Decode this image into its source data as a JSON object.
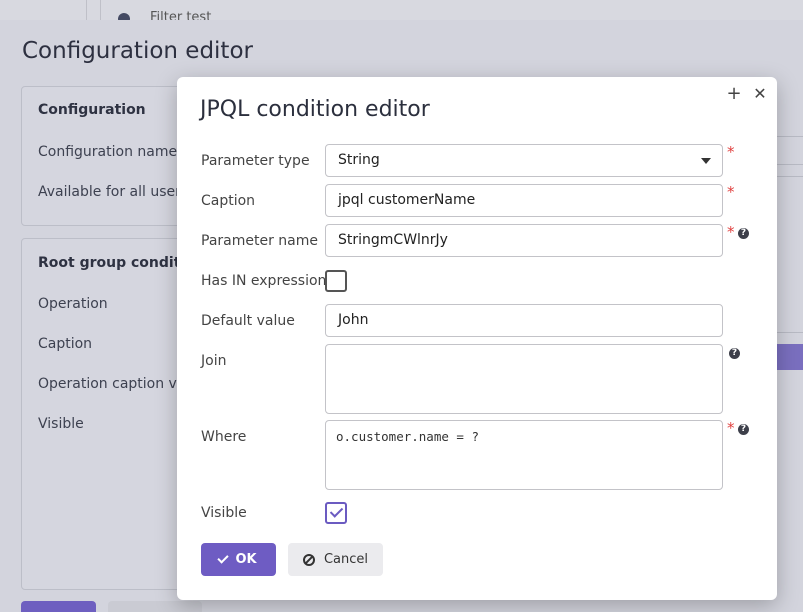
{
  "background": {
    "top_item_label": "Filter test",
    "page_title": "Configuration editor",
    "configuration_panel": {
      "header": "Configuration",
      "fields": [
        "Configuration name",
        "Available for all users"
      ]
    },
    "root_group_panel": {
      "header": "Root group condition",
      "fields": [
        "Operation",
        "Caption",
        "Operation caption vis",
        "Visible"
      ]
    }
  },
  "dialog": {
    "title": "JPQL condition editor",
    "maximize_glyph": "+",
    "close_glyph": "✕",
    "parameter_type": {
      "label": "Parameter type",
      "value": "String"
    },
    "caption": {
      "label": "Caption",
      "value": "jpql customerName"
    },
    "parameter_name": {
      "label": "Parameter name",
      "value": "StringmCWlnrJy"
    },
    "has_in_expression": {
      "label": "Has IN expression",
      "checked": false
    },
    "default_value": {
      "label": "Default value",
      "value": "John"
    },
    "join": {
      "label": "Join",
      "value": ""
    },
    "where": {
      "label": "Where",
      "value": "o.customer.name = ?"
    },
    "visible": {
      "label": "Visible",
      "checked": true
    },
    "required_mark": "*",
    "help_glyph": "?",
    "ok_label": "OK",
    "cancel_label": "Cancel"
  },
  "colors": {
    "accent": "#6e5cc3",
    "required": "#e0403f"
  }
}
